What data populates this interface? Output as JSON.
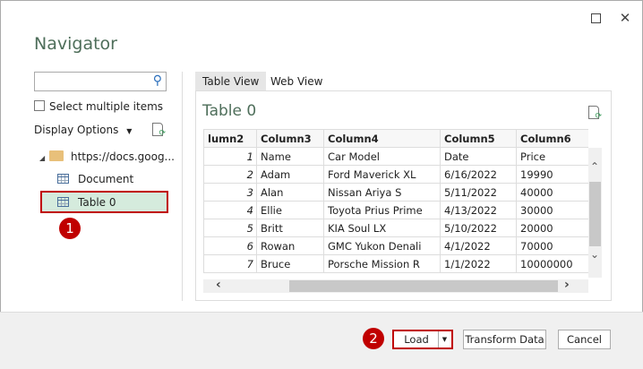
{
  "title": "Navigator",
  "search": {
    "placeholder": ""
  },
  "select_multiple": "Select multiple items",
  "display_options": "Display Options",
  "tree": {
    "root": "https://docs.goog...",
    "items": [
      "Document",
      "Table 0"
    ]
  },
  "badges": [
    "1",
    "2"
  ],
  "tabs": [
    "Table View",
    "Web View"
  ],
  "preview": {
    "title": "Table 0",
    "headers": [
      "lumn2",
      "Column3",
      "Column4",
      "Column5",
      "Column6"
    ],
    "rows": [
      [
        "1",
        "Name",
        "Car Model",
        "Date",
        "Price"
      ],
      [
        "2",
        "Adam",
        "Ford Maverick XL",
        "6/16/2022",
        "19990"
      ],
      [
        "3",
        "Alan",
        "Nissan Ariya S",
        "5/11/2022",
        "40000"
      ],
      [
        "4",
        "Ellie",
        "Toyota Prius Prime",
        "4/13/2022",
        "30000"
      ],
      [
        "5",
        "Britt",
        "KIA Soul LX",
        "5/10/2022",
        "20000"
      ],
      [
        "6",
        "Rowan",
        "GMC Yukon Denali",
        "4/1/2022",
        "70000"
      ],
      [
        "7",
        "Bruce",
        "Porsche Mission R",
        "1/1/2022",
        "10000000"
      ]
    ]
  },
  "buttons": {
    "load": "Load",
    "transform": "Transform Data",
    "cancel": "Cancel"
  },
  "colors": {
    "accent": "#c00000",
    "selected": "#d5ebdd",
    "title": "#4e6e5a"
  }
}
